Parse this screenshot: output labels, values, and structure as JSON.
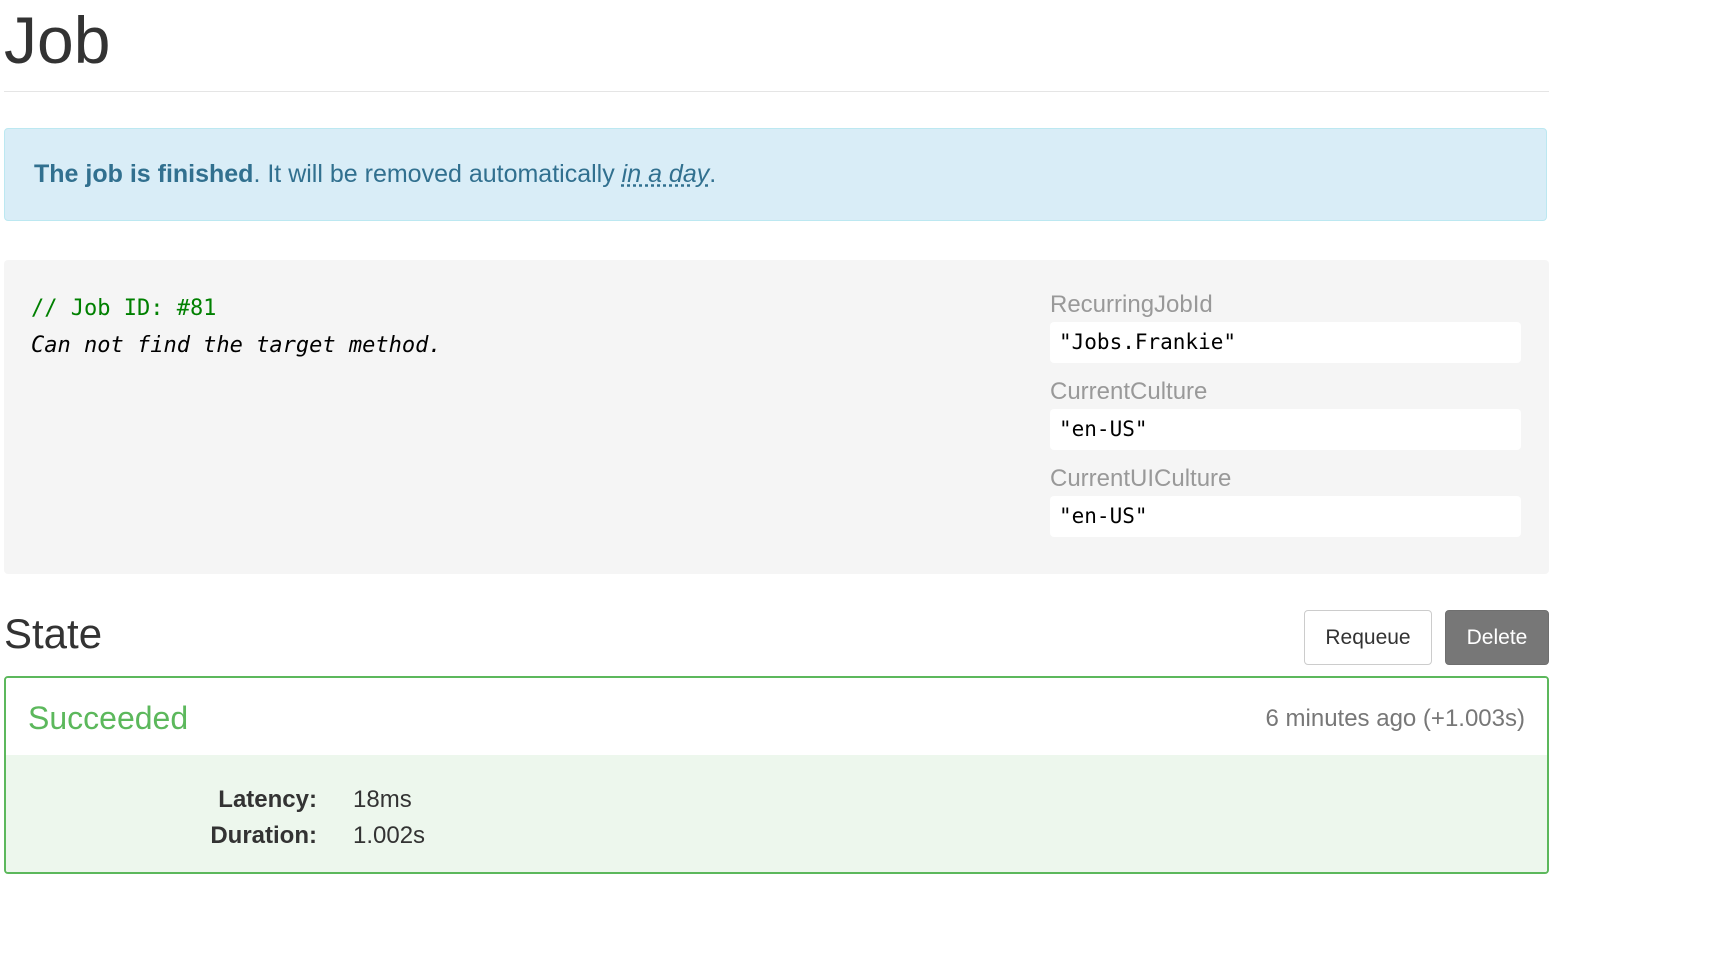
{
  "page": {
    "title": "Job"
  },
  "alert": {
    "strong_text": "The job is finished",
    "middle_text": ". It will be removed automatically ",
    "relative_time": "in a day",
    "end_text": "."
  },
  "job": {
    "id_comment": "// Job ID: #81",
    "method_text": "Can not find the target method.",
    "properties": [
      {
        "label": "RecurringJobId",
        "value": "\"Jobs.Frankie\""
      },
      {
        "label": "CurrentCulture",
        "value": "\"en-US\""
      },
      {
        "label": "CurrentUICulture",
        "value": "\"en-US\""
      }
    ]
  },
  "state": {
    "title": "State",
    "requeue_label": "Requeue",
    "delete_label": "Delete",
    "current": {
      "name": "Succeeded",
      "time": "6 minutes ago (+1.003s)",
      "details": [
        {
          "key": "Latency:",
          "value": "18ms"
        },
        {
          "key": "Duration:",
          "value": "1.002s"
        }
      ]
    }
  },
  "colors": {
    "success": "#5cb85c",
    "info_bg": "#d9edf7",
    "info_text": "#31708f",
    "code_comment": "#008000"
  }
}
